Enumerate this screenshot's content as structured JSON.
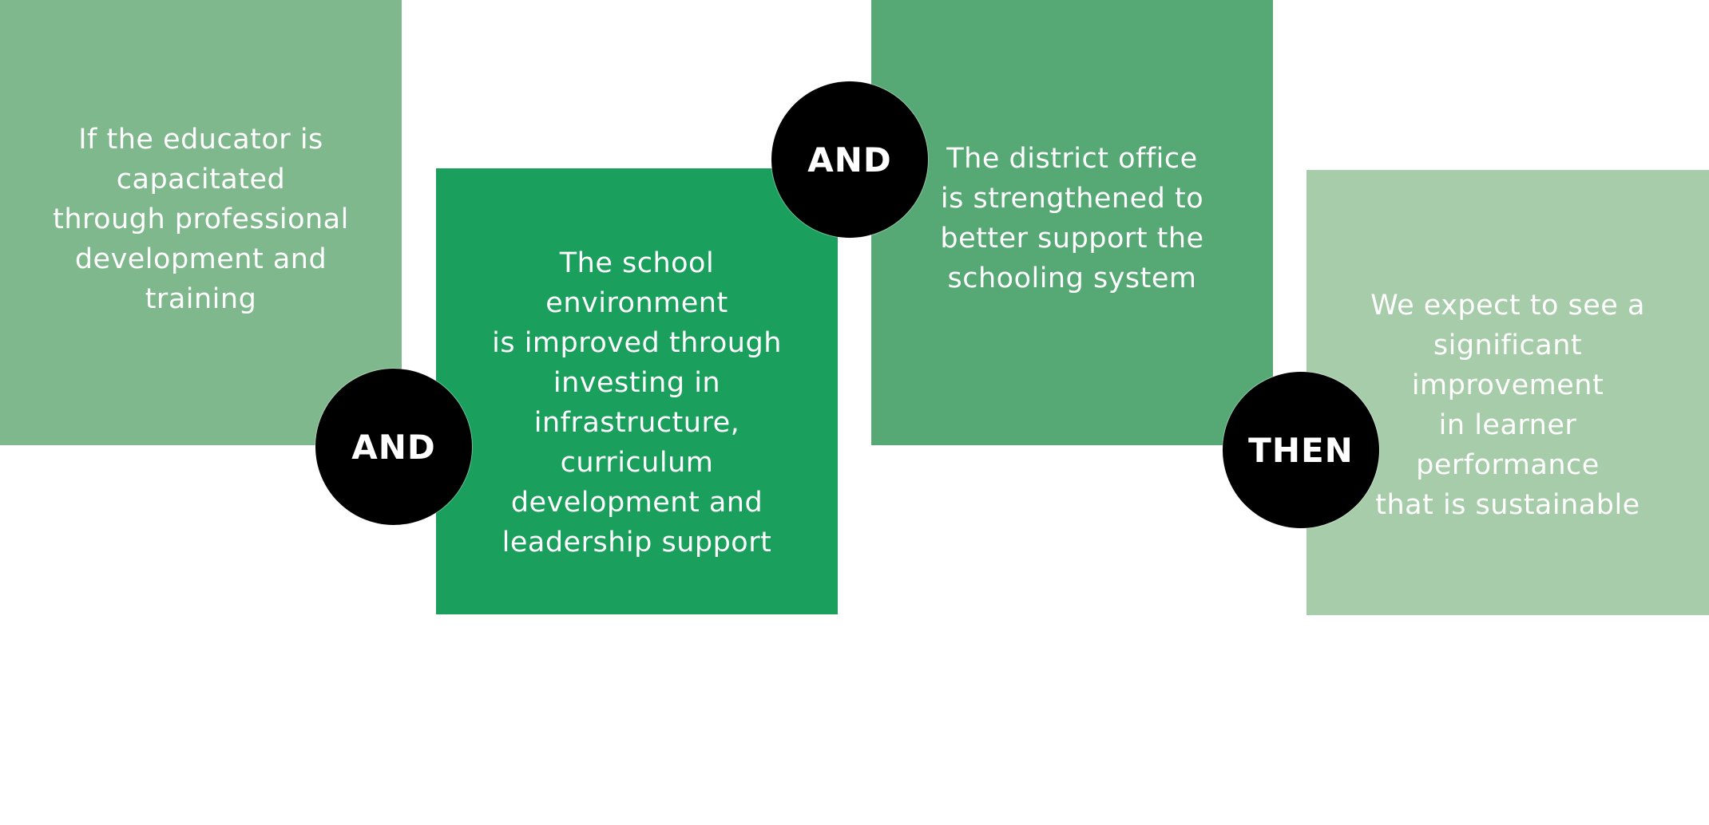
{
  "boxes": [
    {
      "text": "If the educator is\ncapacitated\nthrough professional\ndevelopment and\ntraining",
      "color": "#7fb88d"
    },
    {
      "text": "The school\nenvironment\nis improved through\ninvesting in\ninfrastructure,\ncurriculum\ndevelopment and\nleadership support",
      "color": "#1a9f5c"
    },
    {
      "text": "The district office\nis strengthened to\nbetter support the\nschooling system",
      "color": "#56a874"
    },
    {
      "text": "We expect to see a\nsignificant\nimprovement\nin learner\nperformance\nthat is sustainable",
      "color": "#a7cca9"
    }
  ],
  "connectors": [
    {
      "label": "AND"
    },
    {
      "label": "AND"
    },
    {
      "label": "THEN"
    }
  ]
}
